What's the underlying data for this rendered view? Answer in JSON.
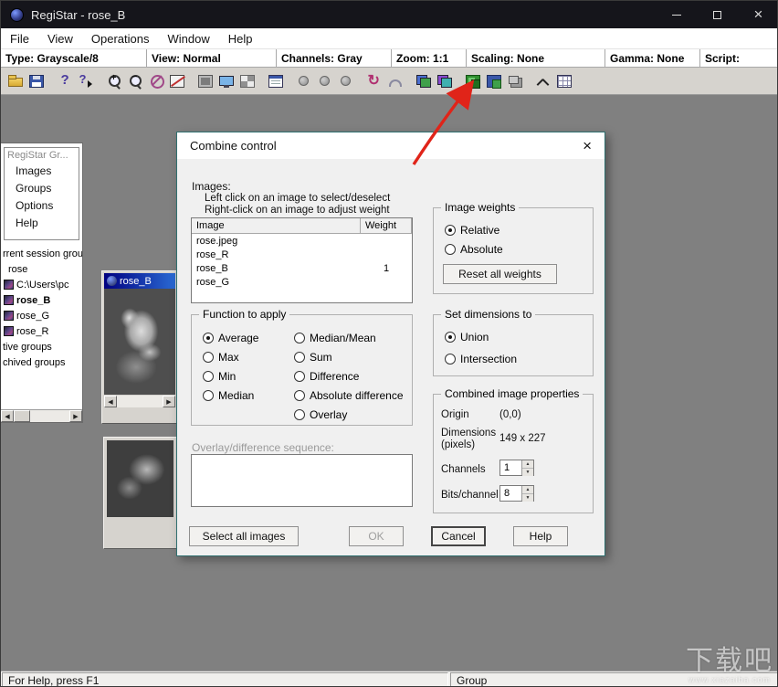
{
  "window": {
    "title": "RegiStar - rose_B"
  },
  "menu": {
    "items": [
      {
        "label": "File"
      },
      {
        "label": "View"
      },
      {
        "label": "Operations"
      },
      {
        "label": "Window"
      },
      {
        "label": "Help"
      }
    ]
  },
  "infobar": {
    "items": [
      {
        "label": "Type:",
        "value": "Grayscale/8"
      },
      {
        "label": "View:",
        "value": "Normal"
      },
      {
        "label": "Channels:",
        "value": "Gray"
      },
      {
        "label": "Zoom:",
        "value": "1:1"
      },
      {
        "label": "Scaling:",
        "value": "None"
      },
      {
        "label": "Gamma:",
        "value": "None"
      },
      {
        "label": "Script:",
        "value": ""
      }
    ]
  },
  "toolbar": {
    "icons": [
      "open",
      "save",
      "help",
      "context-help",
      "zoom-in",
      "zoom-out",
      "no-edit",
      "crop",
      "image",
      "monitor",
      "overlay",
      "info",
      "dot-1",
      "dot-2",
      "dot-3",
      "rotate",
      "arch",
      "register-1",
      "register-2",
      "combine",
      "combine-alt",
      "stack",
      "curve",
      "grid"
    ]
  },
  "sidebar": {
    "title": "RegiStar Gr...",
    "nav": [
      {
        "label": "Images"
      },
      {
        "label": "Groups"
      },
      {
        "label": "Options"
      },
      {
        "label": "Help"
      }
    ],
    "tree": [
      {
        "label": "rrent session group"
      },
      {
        "label": "rose"
      },
      {
        "label": "C:\\Users\\pc"
      },
      {
        "label": "rose_B"
      },
      {
        "label": "rose_G"
      },
      {
        "label": "rose_R"
      },
      {
        "label": "tive groups"
      },
      {
        "label": "chived groups"
      }
    ]
  },
  "image_window": {
    "title": "rose_B"
  },
  "dialog": {
    "title": "Combine control",
    "images_label": "Images:",
    "hint_line1": "Left click on an image to select/deselect",
    "hint_line2": "Right-click on an image to adjust weight",
    "list": {
      "columns": [
        {
          "label": "Image"
        },
        {
          "label": "Weight"
        }
      ],
      "rows": [
        {
          "image": "rose.jpeg",
          "weight": ""
        },
        {
          "image": "rose_R",
          "weight": ""
        },
        {
          "image": "rose_B",
          "weight": "1"
        },
        {
          "image": "rose_G",
          "weight": ""
        }
      ]
    },
    "function_group": {
      "title": "Function to apply",
      "col1": [
        {
          "label": "Average",
          "selected": true
        },
        {
          "label": "Max",
          "selected": false
        },
        {
          "label": "Min",
          "selected": false
        },
        {
          "label": "Median",
          "selected": false
        }
      ],
      "col2": [
        {
          "label": "Median/Mean",
          "selected": false
        },
        {
          "label": "Sum",
          "selected": false
        },
        {
          "label": "Difference",
          "selected": false
        },
        {
          "label": "Absolute difference",
          "selected": false
        },
        {
          "label": "Overlay",
          "selected": false
        }
      ]
    },
    "weights_group": {
      "title": "Image weights",
      "options": [
        {
          "label": "Relative",
          "selected": true
        },
        {
          "label": "Absolute",
          "selected": false
        }
      ],
      "reset_button": "Reset all weights"
    },
    "dimensions_group": {
      "title": "Set dimensions to",
      "options": [
        {
          "label": "Union",
          "selected": true
        },
        {
          "label": "Intersection",
          "selected": false
        }
      ]
    },
    "properties_group": {
      "title": "Combined image properties",
      "origin_label": "Origin",
      "origin_value": "(0,0)",
      "dimensions_label": "Dimensions (pixels)",
      "dimensions_value": "149 x 227",
      "channels_label": "Channels",
      "channels_value": "1",
      "bits_label": "Bits/channel",
      "bits_value": "8"
    },
    "overlay_label": "Overlay/difference sequence:",
    "overlay_value": "",
    "buttons": {
      "select_all": "Select all images",
      "ok": "OK",
      "cancel": "Cancel",
      "help": "Help"
    }
  },
  "statusbar": {
    "help_text": "For Help, press F1",
    "group_label": "Group"
  },
  "watermark": {
    "text": "下载吧",
    "subtext": "www.xiazaiba.com"
  }
}
